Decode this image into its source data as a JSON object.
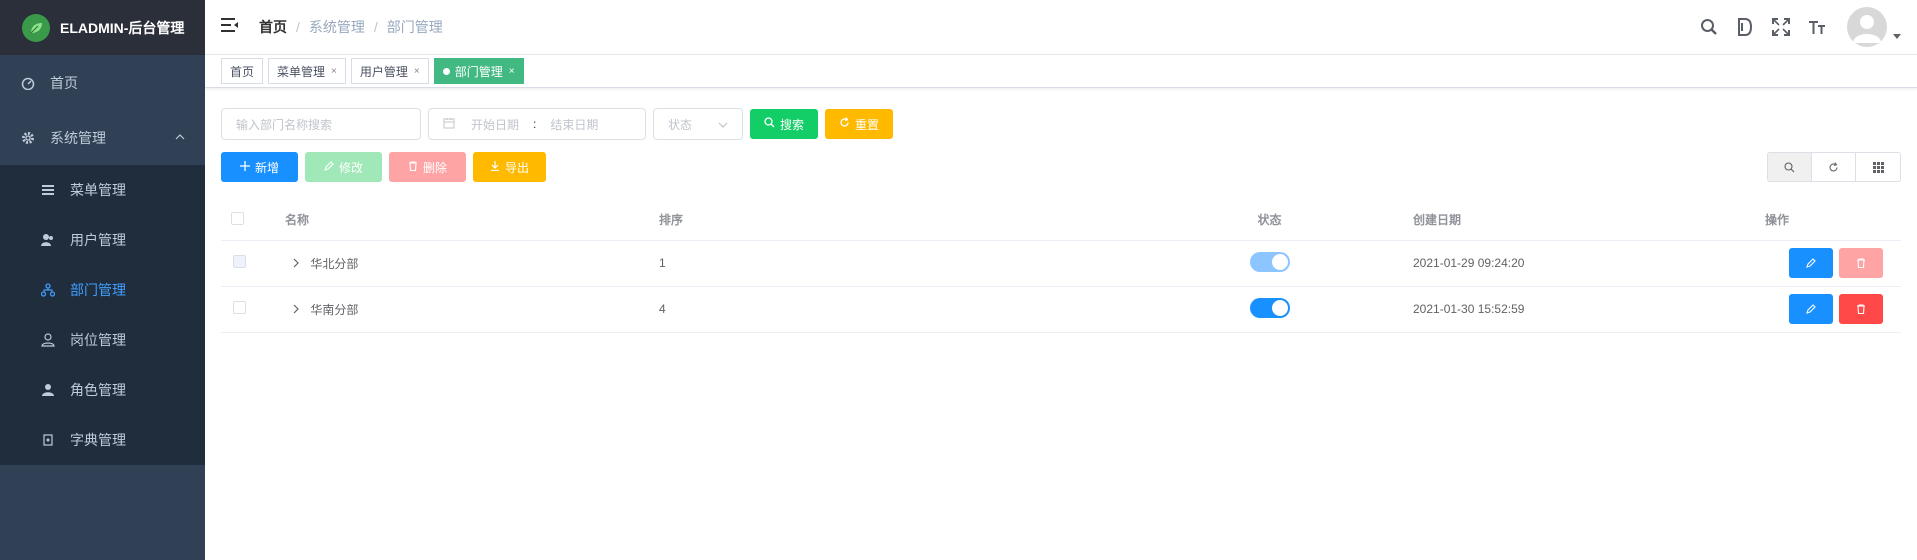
{
  "app": {
    "title": "ELADMIN-后台管理"
  },
  "sidebar": {
    "items": [
      {
        "label": "首页",
        "icon": "dashboard-icon"
      },
      {
        "label": "系统管理",
        "icon": "gear-icon"
      }
    ],
    "submenu": [
      {
        "label": "菜单管理",
        "icon": "menu-icon"
      },
      {
        "label": "用户管理",
        "icon": "user-icon"
      },
      {
        "label": "部门管理",
        "icon": "dept-icon"
      },
      {
        "label": "岗位管理",
        "icon": "post-icon"
      },
      {
        "label": "角色管理",
        "icon": "role-icon"
      },
      {
        "label": "字典管理",
        "icon": "dict-icon"
      }
    ]
  },
  "breadcrumb": [
    "首页",
    "系统管理",
    "部门管理"
  ],
  "tags": [
    {
      "label": "首页",
      "active": false
    },
    {
      "label": "菜单管理",
      "active": false
    },
    {
      "label": "用户管理",
      "active": false
    },
    {
      "label": "部门管理",
      "active": true
    }
  ],
  "filters": {
    "name_placeholder": "输入部门名称搜索",
    "start_placeholder": "开始日期",
    "range_sep": ":",
    "end_placeholder": "结束日期",
    "status_placeholder": "状态",
    "search_label": "搜索",
    "reset_label": "重置"
  },
  "toolbar": {
    "add_label": "新增",
    "edit_label": "修改",
    "delete_label": "删除",
    "export_label": "导出"
  },
  "table": {
    "headers": [
      "名称",
      "排序",
      "状态",
      "创建日期",
      "操作"
    ],
    "rows": [
      {
        "name": "华北分部",
        "sort": "1",
        "status": true,
        "created": "2021-01-29 09:24:20"
      },
      {
        "name": "华南分部",
        "sort": "4",
        "status": true,
        "created": "2021-01-30 15:52:59"
      }
    ]
  },
  "colors": {
    "sidebar_bg": "#304156",
    "primary": "#1890ff",
    "success": "#13ce66",
    "warning": "#ffba00",
    "danger": "#ff4949",
    "tag_active": "#42b983"
  }
}
